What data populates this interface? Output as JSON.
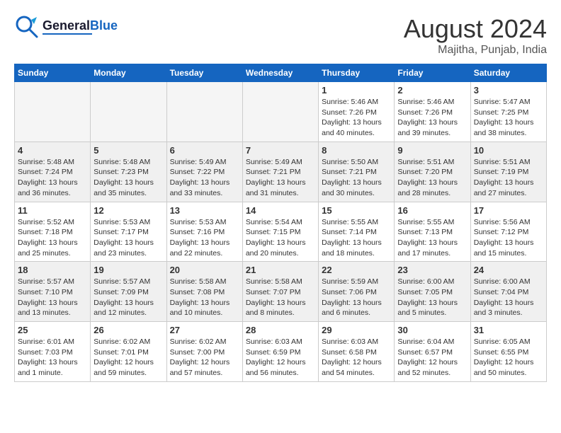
{
  "logo": {
    "line1": "General",
    "line2": "Blue"
  },
  "title": "August 2024",
  "location": "Majitha, Punjab, India",
  "weekdays": [
    "Sunday",
    "Monday",
    "Tuesday",
    "Wednesday",
    "Thursday",
    "Friday",
    "Saturday"
  ],
  "weeks": [
    [
      {
        "day": "",
        "empty": true
      },
      {
        "day": "",
        "empty": true
      },
      {
        "day": "",
        "empty": true
      },
      {
        "day": "",
        "empty": true
      },
      {
        "day": "1",
        "info": "Sunrise: 5:46 AM\nSunset: 7:26 PM\nDaylight: 13 hours\nand 40 minutes."
      },
      {
        "day": "2",
        "info": "Sunrise: 5:46 AM\nSunset: 7:26 PM\nDaylight: 13 hours\nand 39 minutes."
      },
      {
        "day": "3",
        "info": "Sunrise: 5:47 AM\nSunset: 7:25 PM\nDaylight: 13 hours\nand 38 minutes."
      }
    ],
    [
      {
        "day": "4",
        "info": "Sunrise: 5:48 AM\nSunset: 7:24 PM\nDaylight: 13 hours\nand 36 minutes."
      },
      {
        "day": "5",
        "info": "Sunrise: 5:48 AM\nSunset: 7:23 PM\nDaylight: 13 hours\nand 35 minutes."
      },
      {
        "day": "6",
        "info": "Sunrise: 5:49 AM\nSunset: 7:22 PM\nDaylight: 13 hours\nand 33 minutes."
      },
      {
        "day": "7",
        "info": "Sunrise: 5:49 AM\nSunset: 7:21 PM\nDaylight: 13 hours\nand 31 minutes."
      },
      {
        "day": "8",
        "info": "Sunrise: 5:50 AM\nSunset: 7:21 PM\nDaylight: 13 hours\nand 30 minutes."
      },
      {
        "day": "9",
        "info": "Sunrise: 5:51 AM\nSunset: 7:20 PM\nDaylight: 13 hours\nand 28 minutes."
      },
      {
        "day": "10",
        "info": "Sunrise: 5:51 AM\nSunset: 7:19 PM\nDaylight: 13 hours\nand 27 minutes."
      }
    ],
    [
      {
        "day": "11",
        "info": "Sunrise: 5:52 AM\nSunset: 7:18 PM\nDaylight: 13 hours\nand 25 minutes."
      },
      {
        "day": "12",
        "info": "Sunrise: 5:53 AM\nSunset: 7:17 PM\nDaylight: 13 hours\nand 23 minutes."
      },
      {
        "day": "13",
        "info": "Sunrise: 5:53 AM\nSunset: 7:16 PM\nDaylight: 13 hours\nand 22 minutes."
      },
      {
        "day": "14",
        "info": "Sunrise: 5:54 AM\nSunset: 7:15 PM\nDaylight: 13 hours\nand 20 minutes."
      },
      {
        "day": "15",
        "info": "Sunrise: 5:55 AM\nSunset: 7:14 PM\nDaylight: 13 hours\nand 18 minutes."
      },
      {
        "day": "16",
        "info": "Sunrise: 5:55 AM\nSunset: 7:13 PM\nDaylight: 13 hours\nand 17 minutes."
      },
      {
        "day": "17",
        "info": "Sunrise: 5:56 AM\nSunset: 7:12 PM\nDaylight: 13 hours\nand 15 minutes."
      }
    ],
    [
      {
        "day": "18",
        "info": "Sunrise: 5:57 AM\nSunset: 7:10 PM\nDaylight: 13 hours\nand 13 minutes."
      },
      {
        "day": "19",
        "info": "Sunrise: 5:57 AM\nSunset: 7:09 PM\nDaylight: 13 hours\nand 12 minutes."
      },
      {
        "day": "20",
        "info": "Sunrise: 5:58 AM\nSunset: 7:08 PM\nDaylight: 13 hours\nand 10 minutes."
      },
      {
        "day": "21",
        "info": "Sunrise: 5:58 AM\nSunset: 7:07 PM\nDaylight: 13 hours\nand 8 minutes."
      },
      {
        "day": "22",
        "info": "Sunrise: 5:59 AM\nSunset: 7:06 PM\nDaylight: 13 hours\nand 6 minutes."
      },
      {
        "day": "23",
        "info": "Sunrise: 6:00 AM\nSunset: 7:05 PM\nDaylight: 13 hours\nand 5 minutes."
      },
      {
        "day": "24",
        "info": "Sunrise: 6:00 AM\nSunset: 7:04 PM\nDaylight: 13 hours\nand 3 minutes."
      }
    ],
    [
      {
        "day": "25",
        "info": "Sunrise: 6:01 AM\nSunset: 7:03 PM\nDaylight: 13 hours\nand 1 minute."
      },
      {
        "day": "26",
        "info": "Sunrise: 6:02 AM\nSunset: 7:01 PM\nDaylight: 12 hours\nand 59 minutes."
      },
      {
        "day": "27",
        "info": "Sunrise: 6:02 AM\nSunset: 7:00 PM\nDaylight: 12 hours\nand 57 minutes."
      },
      {
        "day": "28",
        "info": "Sunrise: 6:03 AM\nSunset: 6:59 PM\nDaylight: 12 hours\nand 56 minutes."
      },
      {
        "day": "29",
        "info": "Sunrise: 6:03 AM\nSunset: 6:58 PM\nDaylight: 12 hours\nand 54 minutes."
      },
      {
        "day": "30",
        "info": "Sunrise: 6:04 AM\nSunset: 6:57 PM\nDaylight: 12 hours\nand 52 minutes."
      },
      {
        "day": "31",
        "info": "Sunrise: 6:05 AM\nSunset: 6:55 PM\nDaylight: 12 hours\nand 50 minutes."
      }
    ]
  ]
}
